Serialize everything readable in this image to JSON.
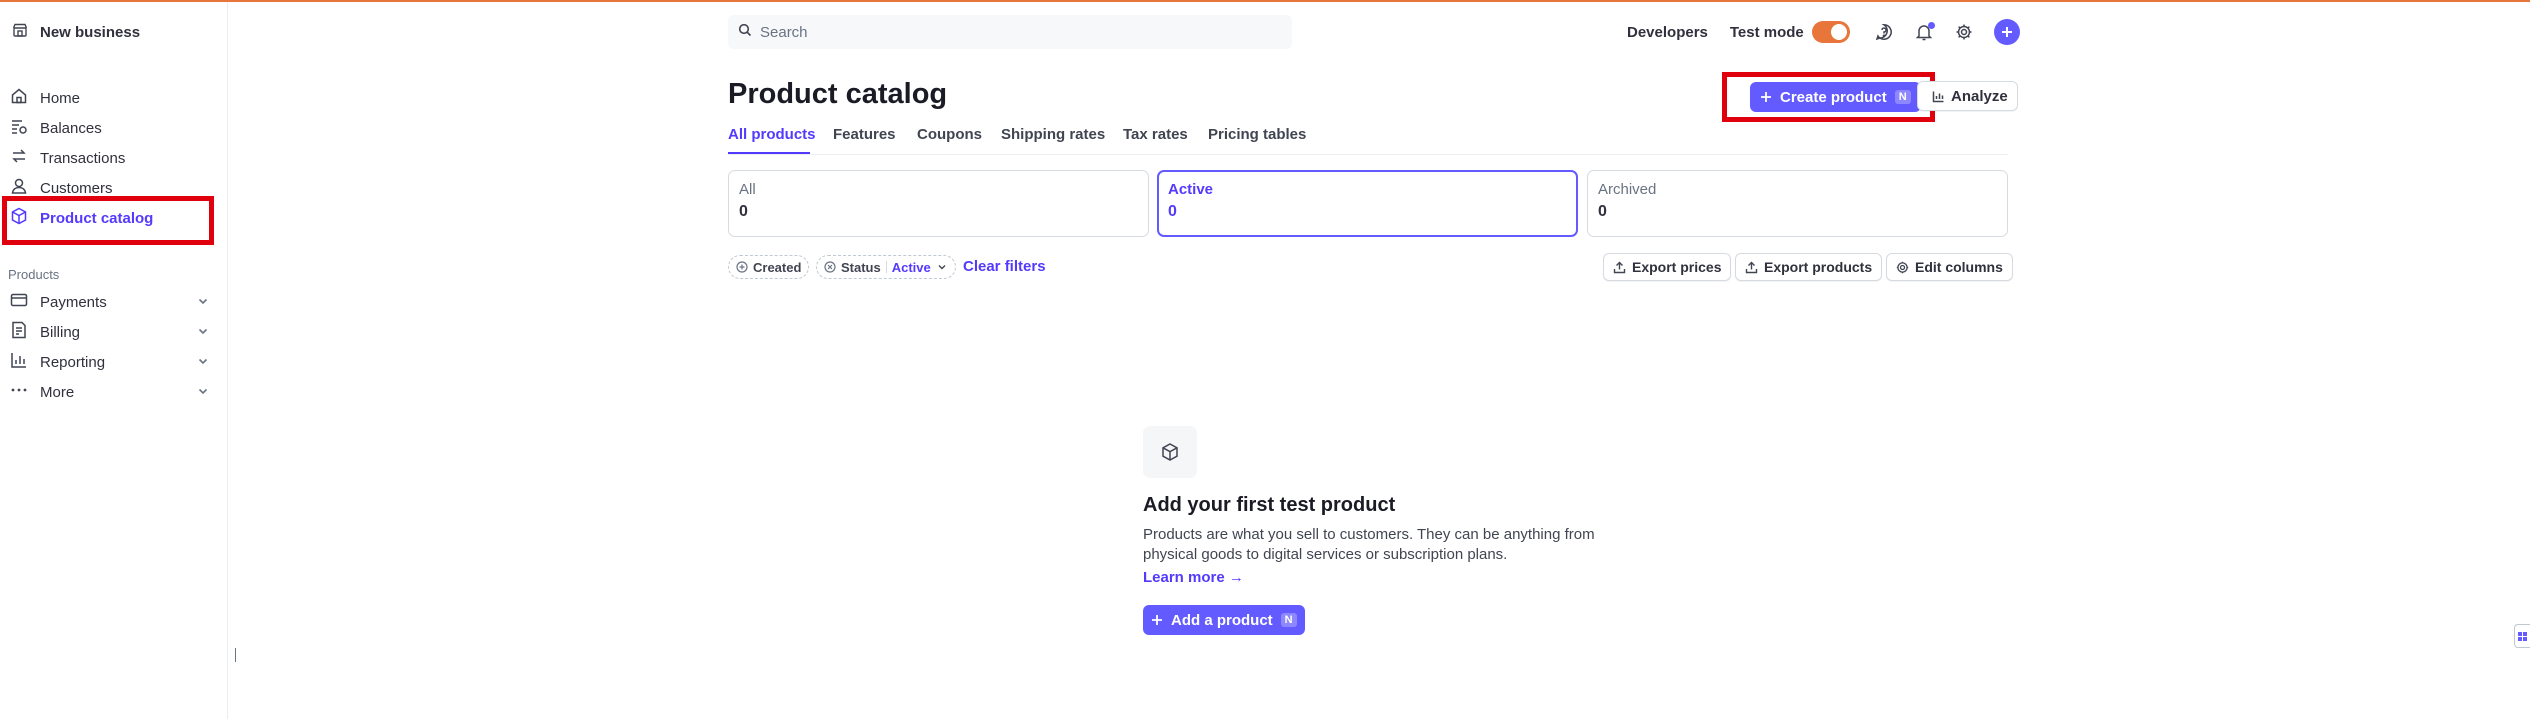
{
  "account": {
    "name": "New business",
    "icon": "store-icon"
  },
  "sidebar": {
    "items": [
      {
        "label": "Home",
        "icon": "home-icon"
      },
      {
        "label": "Balances",
        "icon": "balances-icon"
      },
      {
        "label": "Transactions",
        "icon": "transactions-icon"
      },
      {
        "label": "Customers",
        "icon": "customers-icon"
      },
      {
        "label": "Product catalog",
        "icon": "product-catalog-icon",
        "active": true
      }
    ],
    "section_label": "Products",
    "product_items": [
      {
        "label": "Payments",
        "icon": "payments-icon"
      },
      {
        "label": "Billing",
        "icon": "billing-icon"
      },
      {
        "label": "Reporting",
        "icon": "reporting-icon"
      },
      {
        "label": "More",
        "icon": "more-icon"
      }
    ]
  },
  "topbar": {
    "search_placeholder": "Search",
    "developers": "Developers",
    "test_mode": "Test mode",
    "test_mode_on": true
  },
  "page": {
    "title": "Product catalog",
    "create_button": "Create product",
    "create_shortcut": "N",
    "analyze_button": "Analyze",
    "tabs": [
      "All products",
      "Features",
      "Coupons",
      "Shipping rates",
      "Tax rates",
      "Pricing tables"
    ],
    "active_tab": "All products",
    "status_cards": [
      {
        "label": "All",
        "value": "0"
      },
      {
        "label": "Active",
        "value": "0",
        "active": true
      },
      {
        "label": "Archived",
        "value": "0"
      }
    ],
    "filters": {
      "created": "Created",
      "status": "Status",
      "status_value": "Active",
      "clear": "Clear filters"
    },
    "actions": {
      "export_prices": "Export prices",
      "export_products": "Export products",
      "edit_columns": "Edit columns"
    }
  },
  "empty_state": {
    "title": "Add your first test product",
    "description": "Products are what you sell to customers. They can be anything from physical goods to digital services or subscription plans.",
    "learn_more": "Learn more →",
    "add_button": "Add a product",
    "add_shortcut": "N"
  },
  "colors": {
    "accent": "#635bff",
    "accent_text": "#533afd",
    "test_mode_orange": "#e8763a",
    "highlight_red": "#e0000d"
  }
}
